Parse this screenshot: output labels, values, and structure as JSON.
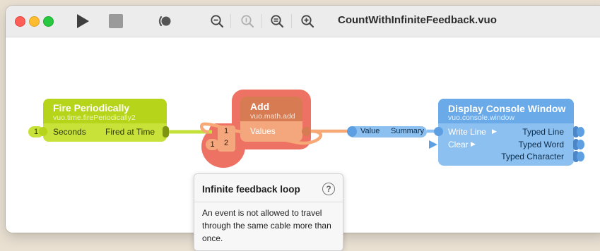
{
  "window": {
    "title": "CountWithInfiniteFeedback.vuo"
  },
  "toolbar": {
    "run_icon": "play-icon",
    "stop_icon": "stop-icon",
    "show_events_icon": "show-events-icon",
    "zoom_out_icon": "zoom-out-icon",
    "zoom_actual_icon": "zoom-actual-size-icon",
    "zoom_fit_icon": "zoom-to-fit-icon",
    "zoom_in_icon": "zoom-in-icon"
  },
  "nodes": {
    "fire_periodically": {
      "title": "Fire Periodically",
      "class_name": "vuo.time.firePeriodically2",
      "input_label": "Seconds",
      "input_constant": "1",
      "output_label": "Fired at Time",
      "color": "#b6d41a"
    },
    "add": {
      "title": "Add",
      "class_name": "vuo.math.add",
      "input_label": "Values",
      "list_item_1": "1",
      "list_item_2": "2",
      "list_constant": "1",
      "color": "#f4a77c"
    },
    "summary": {
      "input_label": "Value",
      "output_label": "Summary",
      "color": "#8cc0f0"
    },
    "display_console_window": {
      "title": "Display Console Window",
      "class_name": "vuo.console.window",
      "input_1": "Write Line",
      "input_2": "Clear",
      "output_1": "Typed Line",
      "output_2": "Typed Word",
      "output_3": "Typed Character",
      "color": "#6aaae8"
    }
  },
  "tooltip": {
    "title": "Infinite feedback loop",
    "help_glyph": "?",
    "body": "An event is not allowed to travel through the same cable more than once."
  },
  "colors": {
    "error_highlight": "#ee7264",
    "lime_cable": "#c4e03a",
    "orange_cable": "#f6a877",
    "blue_cable": "#8cc0f0"
  }
}
